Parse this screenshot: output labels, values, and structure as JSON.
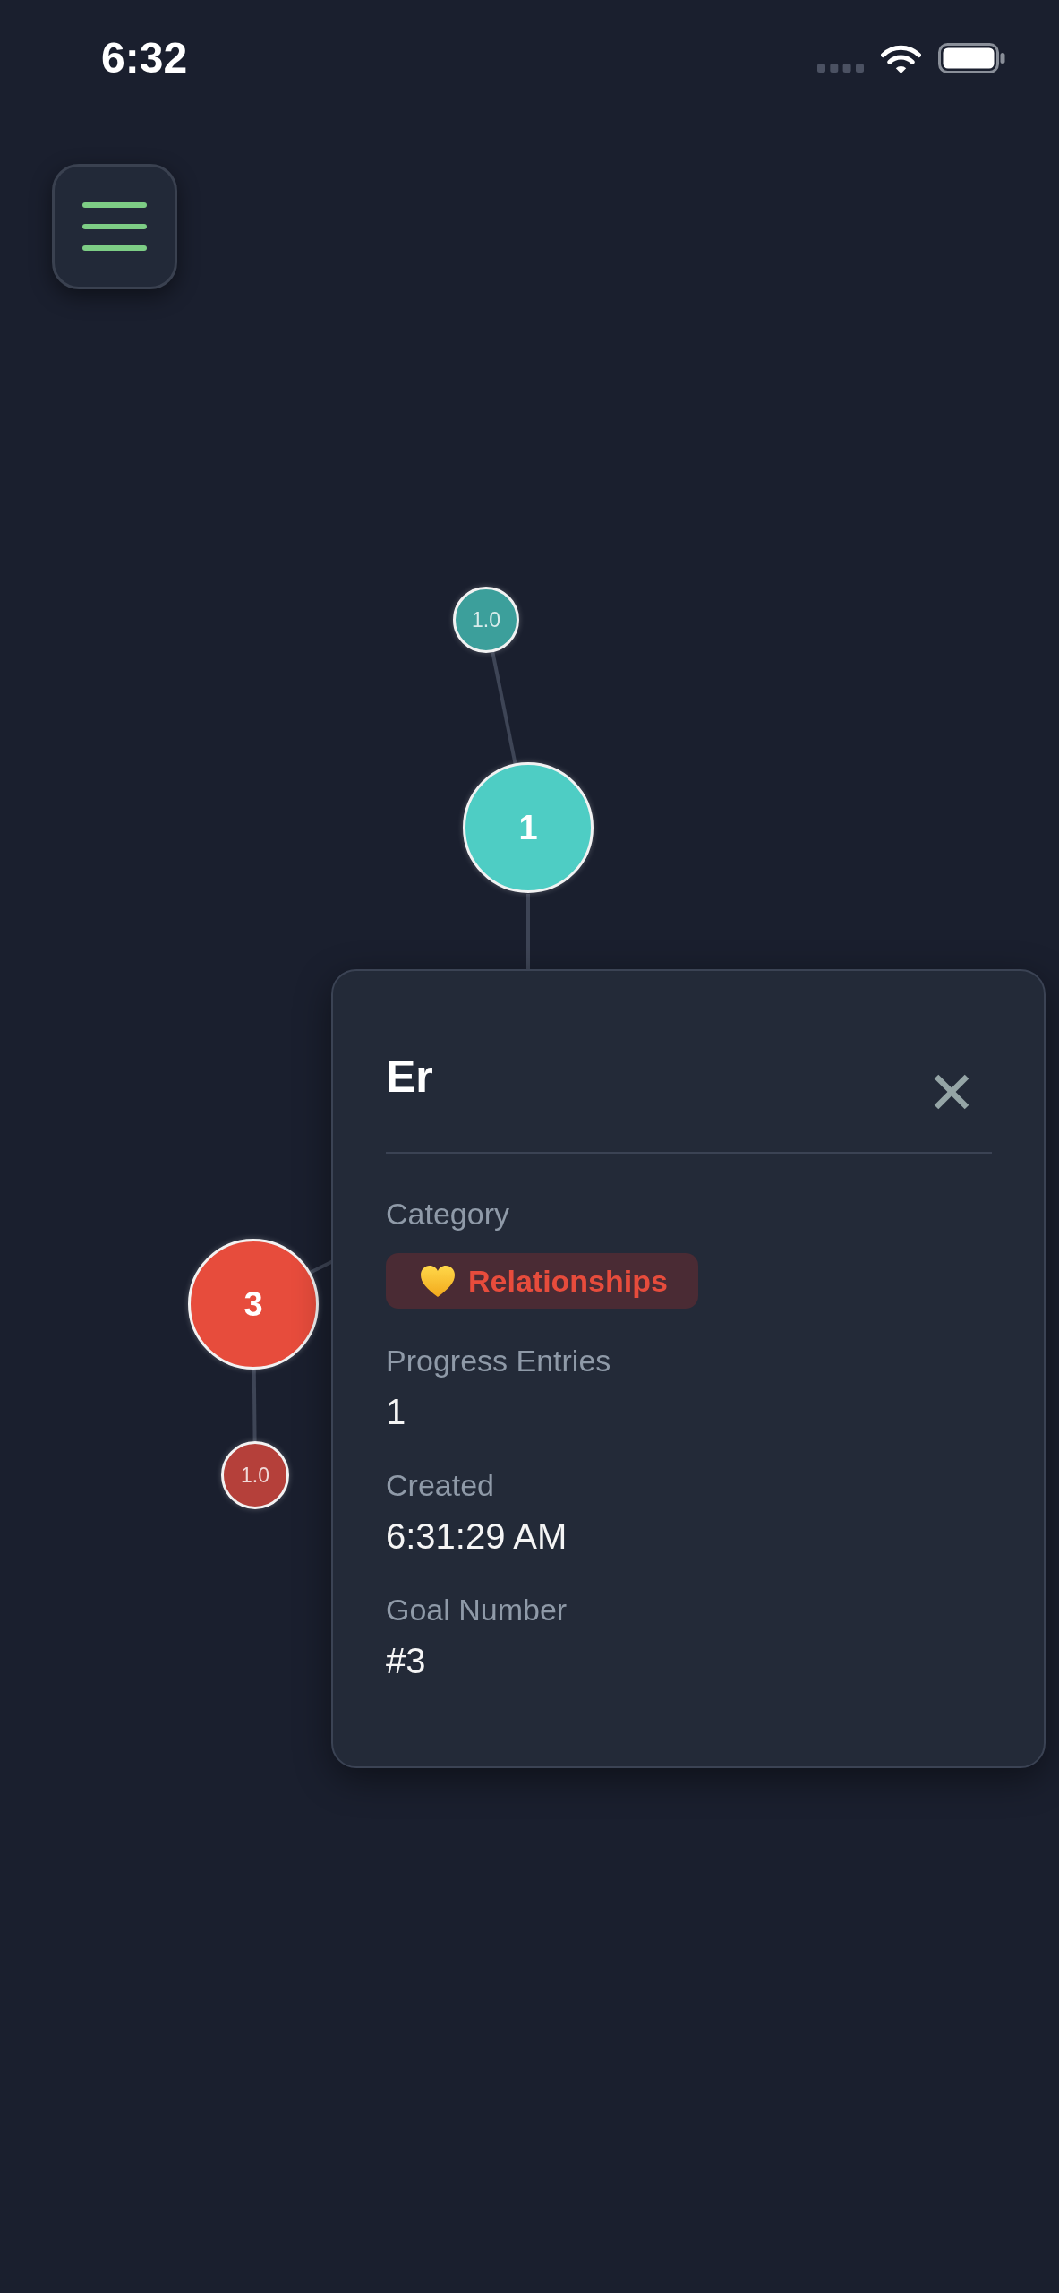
{
  "status_bar": {
    "time": "6:32"
  },
  "graph": {
    "goals": [
      {
        "label": "1",
        "color": "#4ecdc4",
        "entries": [
          {
            "label": "1.0",
            "color": "#3c9f9b"
          }
        ]
      },
      {
        "label": "3",
        "color": "#e74c3c",
        "entries": [
          {
            "label": "1.0",
            "color": "#b5403a"
          }
        ]
      }
    ]
  },
  "detail_card": {
    "title": "Er",
    "category": {
      "label": "Category",
      "value": "Relationships"
    },
    "fields": [
      {
        "label": "Progress Entries",
        "value": "1"
      },
      {
        "label": "Created",
        "value": "6:31:29 AM"
      },
      {
        "label": "Goal Number",
        "value": "#3"
      }
    ]
  }
}
